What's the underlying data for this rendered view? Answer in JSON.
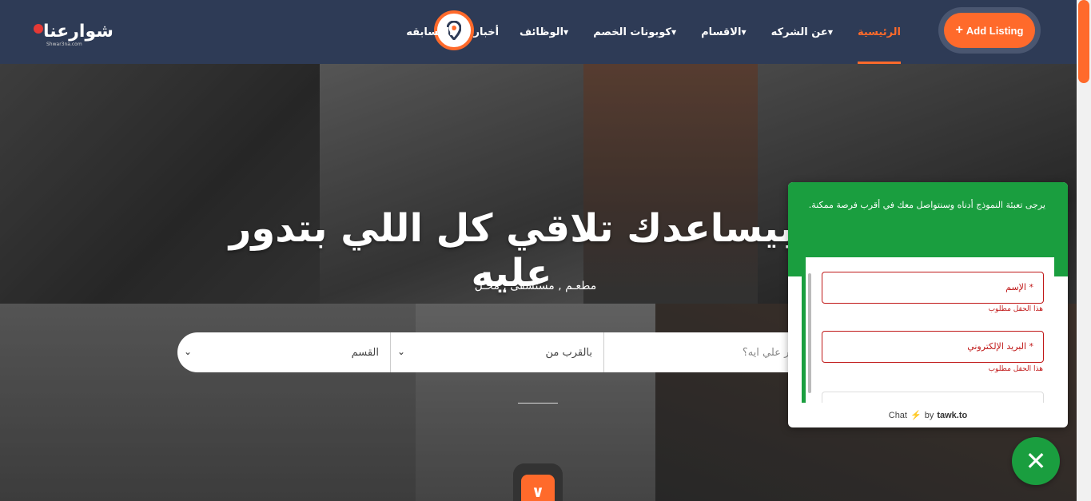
{
  "header": {
    "logo_text": "شوارعنا",
    "logo_sub": "Shwar3na.com",
    "add_listing_label": "Add Listing",
    "nav": [
      {
        "label": "الرئيسية",
        "active": true,
        "caret": false
      },
      {
        "label": "عن الشركه",
        "active": false,
        "caret": true
      },
      {
        "label": "الاقسام",
        "active": false,
        "caret": true
      },
      {
        "label": "كوبونات الخصم",
        "active": false,
        "caret": true
      },
      {
        "label": "الوظائف",
        "active": false,
        "caret": true
      },
      {
        "label": "أخبار",
        "active": false,
        "caret": false
      },
      {
        "label": "المسابقه",
        "active": false,
        "caret": false
      }
    ]
  },
  "hero": {
    "title": "بيساعدك تلاقي كل اللي بتدور عليه",
    "subtitle": "مطعـم , مستشفى , محـل"
  },
  "search": {
    "query_placeholder": "بتدور علي ايه؟",
    "near_label": "بالقرب من",
    "category_label": "القسم"
  },
  "chat": {
    "message": "يرجى تعبئة النموذج أدناه وسنتواصل معك في أقرب فرصة ممكنة.",
    "name_label": "* الإسم",
    "name_error": "هذا الحقل مطلوب",
    "email_label": "* البريد الإلكتروني",
    "email_error": "هذا الحقل مطلوب",
    "footer_chat": "Chat",
    "footer_by": "by",
    "footer_brand": "tawk.to"
  },
  "colors": {
    "accent": "#ff6a2b",
    "header_bg": "#2e3b56",
    "chat_green": "#1a9e3f",
    "error_red": "#c01818"
  },
  "icons": [
    "map-pin-icon",
    "plus-icon",
    "chevron-down-icon",
    "double-chevron-down-icon",
    "close-icon",
    "lightning-icon"
  ]
}
